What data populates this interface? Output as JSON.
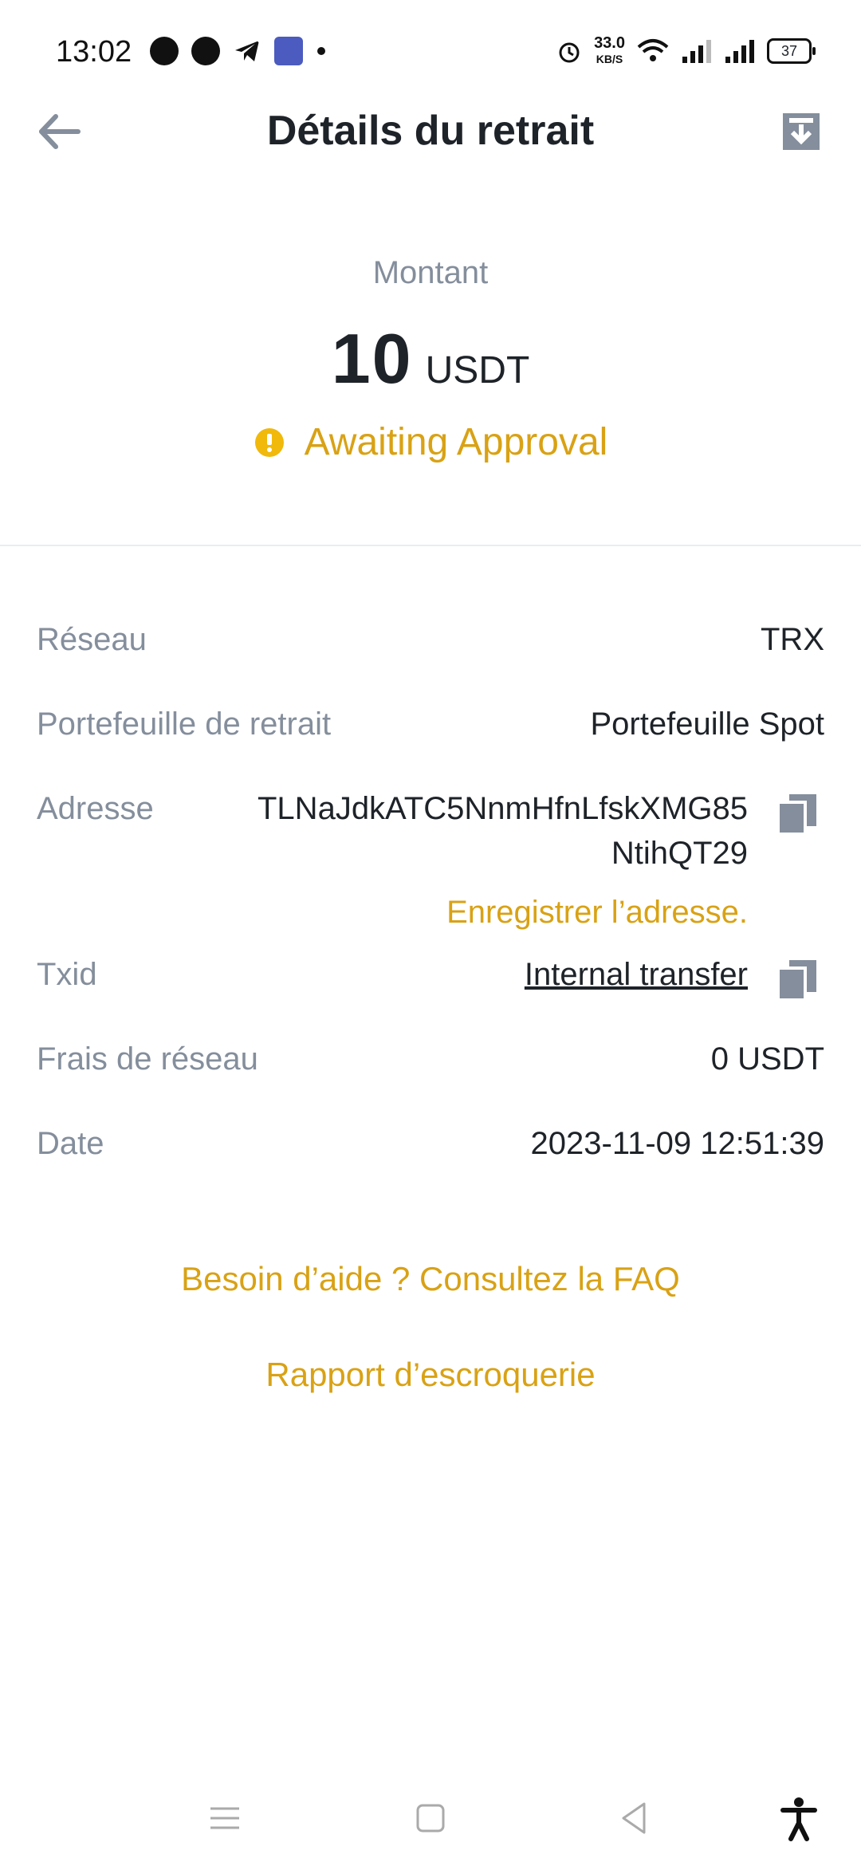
{
  "status_bar": {
    "time": "13:02",
    "net_speed": "33.0",
    "net_speed_unit": "KB/S",
    "battery": "37"
  },
  "header": {
    "title": "Détails du retrait"
  },
  "summary": {
    "amount_label": "Montant",
    "amount": "10",
    "currency": "USDT",
    "status": "Awaiting Approval",
    "status_color": "#d9a215"
  },
  "details": {
    "network_label": "Réseau",
    "network_value": "TRX",
    "wallet_label": "Portefeuille de retrait",
    "wallet_value": "Portefeuille Spot",
    "address_label": "Adresse",
    "address_value": "TLNaJdkATC5NnmHfnLfskXMG85NtihQT29",
    "save_address": "Enregistrer l’adresse.",
    "txid_label": "Txid",
    "txid_value": "Internal transfer",
    "fee_label": "Frais de réseau",
    "fee_value": "0 USDT",
    "date_label": "Date",
    "date_value": "2023-11-09 12:51:39"
  },
  "links": {
    "help": "Besoin d’aide ? Consultez la FAQ",
    "scam": "Rapport d’escroquerie"
  },
  "colors": {
    "accent": "#d9a215",
    "label": "#848e9c",
    "text": "#1e2329"
  }
}
